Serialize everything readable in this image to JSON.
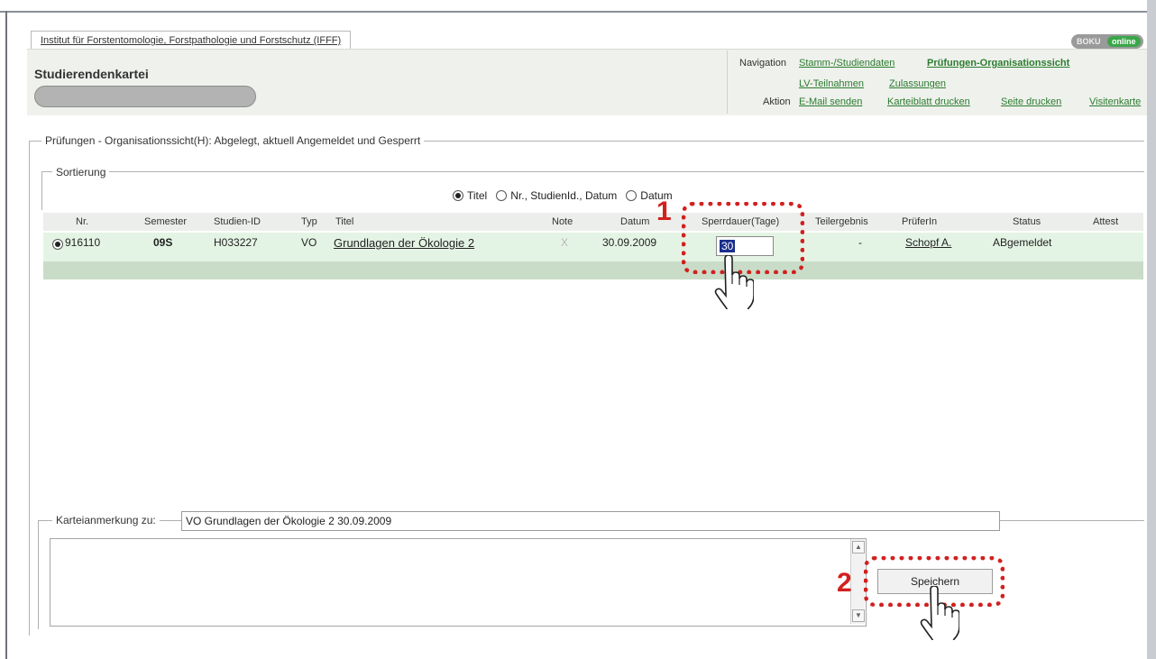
{
  "institute_tab": "Institut für Forstentomologie, Forstpathologie und Forstschutz (IFFF)",
  "brand": {
    "part1": "BOKU",
    "part2": "online"
  },
  "page_title": "Studierendenkartei",
  "nav": {
    "navigation_label": "Navigation",
    "action_label": "Aktion",
    "nav_links": [
      "Stamm-/Studiendaten",
      "Prüfungen-Organisationssicht",
      "LV-Teilnahmen",
      "Zulassungen"
    ],
    "action_links": [
      "E-Mail senden",
      "Karteiblatt drucken",
      "Seite drucken",
      "Visitenkarte"
    ]
  },
  "section_legend": "Prüfungen - Organisationssicht(H): Abgelegt, aktuell Angemeldet und Gesperrt",
  "sort": {
    "legend": "Sortierung",
    "options": [
      "Titel",
      "Nr., StudienId., Datum",
      "Datum"
    ],
    "selected": "Titel"
  },
  "table": {
    "columns": [
      "Nr.",
      "Semester",
      "Studien-ID",
      "Typ",
      "Titel",
      "Note",
      "Datum",
      "Sperrdauer(Tage)",
      "Teilergebnis",
      "PrüferIn",
      "Status",
      "Attest"
    ],
    "rows": [
      {
        "nr": "916110",
        "semester": "09S",
        "studien_id": "H033227",
        "typ": "VO",
        "titel": "Grundlagen der Ökologie 2",
        "note": "X",
        "datum": "30.09.2009",
        "sperrdauer": "30",
        "teilergebnis": "-",
        "pruefer": "Schopf A.",
        "status": "ABgemeldet",
        "attest": ""
      }
    ]
  },
  "karte": {
    "label": "Karteianmerkung zu:",
    "value": "VO Grundlagen der Ökologie 2 30.09.2009",
    "save_button": "Speichern"
  },
  "annotations": {
    "step1": "1",
    "step2": "2"
  },
  "colors": {
    "accent_red": "#d1211f",
    "link_green": "#2c7c2f",
    "row_green": "#e4f4e4"
  }
}
